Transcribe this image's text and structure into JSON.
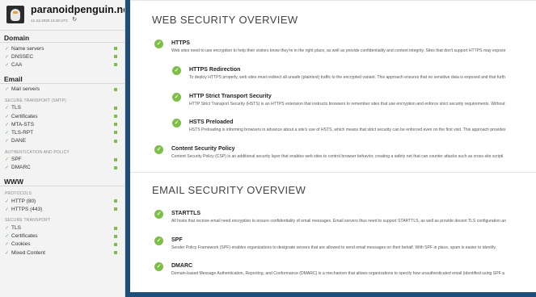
{
  "brand": {
    "site_name": "paranoidpenguin.net",
    "scan_date": "12 Jul 2020 13:48 UTC"
  },
  "sidebar": {
    "domain": {
      "heading": "Domain",
      "items": [
        {
          "label": "Name servers"
        },
        {
          "label": "DNSSEC"
        },
        {
          "label": "CAA"
        }
      ]
    },
    "email": {
      "heading": "Email",
      "items": [
        {
          "label": "Mail servers"
        }
      ],
      "group1_label": "SECURE TRANSPORT (SMTP)",
      "group1_items": [
        {
          "label": "TLS"
        },
        {
          "label": "Certificates"
        },
        {
          "label": "MTA-STS"
        },
        {
          "label": "TLS-RPT"
        },
        {
          "label": "DANE"
        }
      ],
      "group2_label": "AUTHENTICATION AND POLICY",
      "group2_items": [
        {
          "label": "SPF"
        },
        {
          "label": "DMARC"
        }
      ]
    },
    "www": {
      "heading": "WWW",
      "group1_label": "PROTOCOLS",
      "group1_items": [
        {
          "label": "HTTP (80)"
        },
        {
          "label": "HTTPS (443)"
        }
      ],
      "group2_label": "SECURE TRANSPORT",
      "group2_items": [
        {
          "label": "TLS"
        },
        {
          "label": "Certificates"
        },
        {
          "label": "Cookies"
        },
        {
          "label": "Mixed Content"
        }
      ]
    }
  },
  "web_overview": {
    "title": "WEB SECURITY OVERVIEW",
    "items": [
      {
        "title": "HTTPS",
        "desc": "Web sites need to use encryption to help their visitors know they're in the right place, as well as provide confidentiality and content integrity. Sites that don't support HTTPS may expose"
      },
      {
        "title": "HTTPS Redirection",
        "desc": "To deploy HTTPS properly, web sites must redirect all unsafe (plaintext) traffic to the encrypted variant. This approach ensures that no sensitive data is exposed and that furth"
      },
      {
        "title": "HTTP Strict Transport Security",
        "desc": "HTTP Strict Transport Security (HSTS) is an HTTPS extension that instructs browsers to remember sites that use encryption and enforce strict security requirements. Without"
      },
      {
        "title": "HSTS Preloaded",
        "desc": "HSTS Preloading is informing browsers in advance about a site's use of HSTS, which means that strict security can be enforced even on the first visit. This approach provides"
      },
      {
        "title": "Content Security Policy",
        "desc": "Content Security Policy (CSP) is an additional security layer that enables web sites to control browser behavior, creating a safety net that can counter attacks such as cross-site scripti"
      }
    ]
  },
  "email_overview": {
    "title": "EMAIL SECURITY OVERVIEW",
    "items": [
      {
        "title": "STARTTLS",
        "desc": "All hosts that receive email need encryption to ensure confidentiality of email messages. Email servers thus need to support STARTTLS, as well as provide decent TLS configuration an"
      },
      {
        "title": "SPF",
        "desc": "Sender Policy Framework (SPF) enables organizations to designate servers that are allowed to send email messages on their behalf. With SPF in place, spam is easier to identify."
      },
      {
        "title": "DMARC",
        "desc": "Domain-based Message Authentication, Reporting, and Conformance (DMARC) is a mechanism that allows organizations to specify how unauthenticated email (identified using SPF a"
      }
    ]
  },
  "colors": {
    "pass_green": "#7bc043",
    "frame_blue": "#1f4d7a"
  }
}
